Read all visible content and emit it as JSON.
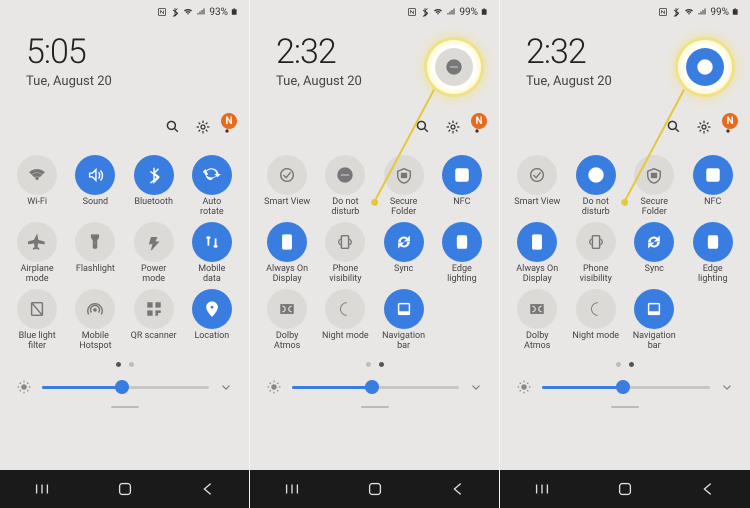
{
  "colors": {
    "accent": "#3a7de0",
    "off": "#dcdad7",
    "bg": "#e9e7e5"
  },
  "panels": [
    {
      "status": {
        "battery_pct": "93%"
      },
      "clock": {
        "time": "5:05",
        "date": "Tue, August 20"
      },
      "page_index": 0,
      "brightness_pct": 48,
      "tiles": [
        {
          "name": "wifi",
          "label": "Wi-Fi",
          "on": false
        },
        {
          "name": "sound",
          "label": "Sound",
          "on": true
        },
        {
          "name": "bluetooth",
          "label": "Bluetooth",
          "on": true
        },
        {
          "name": "autorotate",
          "label": "Auto\nrotate",
          "on": true
        },
        {
          "name": "airplane",
          "label": "Airplane\nmode",
          "on": false
        },
        {
          "name": "flashlight",
          "label": "Flashlight",
          "on": false
        },
        {
          "name": "power",
          "label": "Power\nmode",
          "on": false
        },
        {
          "name": "mobiledata",
          "label": "Mobile\ndata",
          "on": true
        },
        {
          "name": "bluelight",
          "label": "Blue light\nfilter",
          "on": false
        },
        {
          "name": "hotspot",
          "label": "Mobile\nHotspot",
          "on": false
        },
        {
          "name": "qrscan",
          "label": "QR scanner",
          "on": false
        },
        {
          "name": "location",
          "label": "Location",
          "on": true
        }
      ]
    },
    {
      "status": {
        "battery_pct": "99%"
      },
      "clock": {
        "time": "2:32",
        "date": "Tue, August 20"
      },
      "page_index": 1,
      "brightness_pct": 48,
      "callout": {
        "tile": "dnd",
        "on": false
      },
      "tiles": [
        {
          "name": "smartview",
          "label": "Smart View",
          "on": false
        },
        {
          "name": "dnd",
          "label": "Do not\ndisturb",
          "on": false
        },
        {
          "name": "securefolder",
          "label": "Secure\nFolder",
          "on": false
        },
        {
          "name": "nfc",
          "label": "NFC",
          "on": true
        },
        {
          "name": "aod",
          "label": "Always On\nDisplay",
          "on": true
        },
        {
          "name": "phonevis",
          "label": "Phone\nvisibility",
          "on": false
        },
        {
          "name": "sync",
          "label": "Sync",
          "on": true
        },
        {
          "name": "edge",
          "label": "Edge\nlighting",
          "on": true
        },
        {
          "name": "dolby",
          "label": "Dolby\nAtmos",
          "on": false
        },
        {
          "name": "nightmode",
          "label": "Night mode",
          "on": false
        },
        {
          "name": "navbar",
          "label": "Navigation\nbar",
          "on": true
        }
      ]
    },
    {
      "status": {
        "battery_pct": "99%"
      },
      "clock": {
        "time": "2:32",
        "date": "Tue, August 20"
      },
      "page_index": 1,
      "brightness_pct": 48,
      "callout": {
        "tile": "dnd",
        "on": true
      },
      "tiles": [
        {
          "name": "smartview",
          "label": "Smart View",
          "on": false
        },
        {
          "name": "dnd",
          "label": "Do not\ndisturb",
          "on": true
        },
        {
          "name": "securefolder",
          "label": "Secure\nFolder",
          "on": false
        },
        {
          "name": "nfc",
          "label": "NFC",
          "on": true
        },
        {
          "name": "aod",
          "label": "Always On\nDisplay",
          "on": true
        },
        {
          "name": "phonevis",
          "label": "Phone\nvisibility",
          "on": false
        },
        {
          "name": "sync",
          "label": "Sync",
          "on": true
        },
        {
          "name": "edge",
          "label": "Edge\nlighting",
          "on": true
        },
        {
          "name": "dolby",
          "label": "Dolby\nAtmos",
          "on": false
        },
        {
          "name": "nightmode",
          "label": "Night mode",
          "on": false
        },
        {
          "name": "navbar",
          "label": "Navigation\nbar",
          "on": true
        }
      ]
    }
  ]
}
